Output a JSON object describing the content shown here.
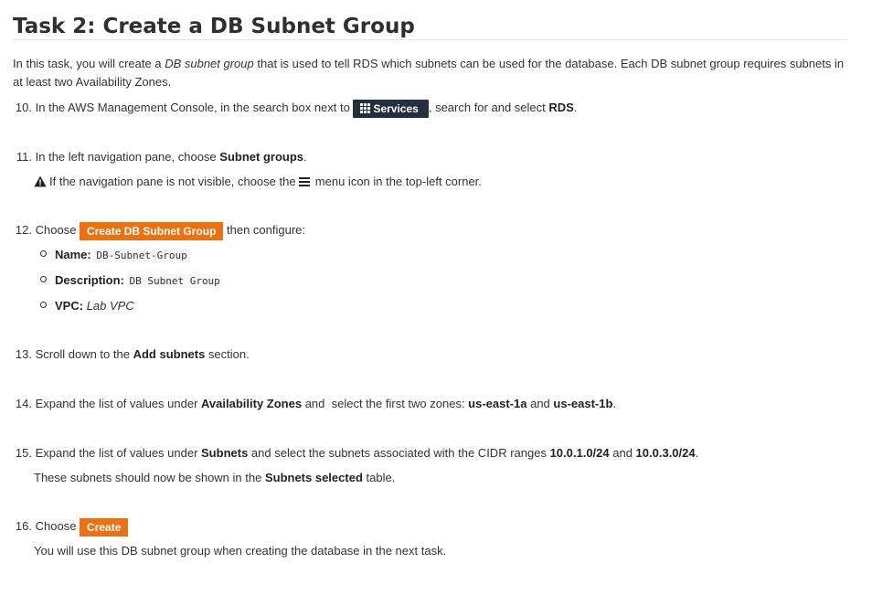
{
  "title": "Task 2: Create a DB Subnet Group",
  "intro": {
    "before": "In this task, you will create a ",
    "em": "DB subnet group",
    "after": " that is used to tell RDS which subnets can be used for the database. Each DB subnet group requires subnets in at least two Availability Zones."
  },
  "steps": {
    "s10": {
      "num": "10.",
      "t1": "In the AWS Management Console, in the search box next to ",
      "button": "Services",
      "t2": ", search for and select ",
      "bold": "RDS",
      "t3": "."
    },
    "s11": {
      "num": "11.",
      "t1": "In the left navigation pane, choose ",
      "bold": "Subnet groups",
      "t2": ".",
      "note": "If the navigation pane is not visible, choose the ",
      "note2": " menu icon in the top-left corner."
    },
    "s12": {
      "num": "12.",
      "t1": "Choose ",
      "button": "Create DB Subnet Group",
      "t2": " then configure:",
      "name_label": "Name:",
      "name_value": "DB-Subnet-Group",
      "desc_label": "Description:",
      "desc_value": "DB Subnet Group",
      "vpc_label": "VPC:",
      "vpc_value": "Lab VPC"
    },
    "s13": {
      "num": "13.",
      "t1": "Scroll down to the ",
      "bold": "Add subnets",
      "t2": " section."
    },
    "s14": {
      "num": "14.",
      "t1": "Expand the list of values under ",
      "bold1": "Availability Zones",
      "t2": " and  select the first two zones: ",
      "bold2": "us-east-1a",
      "t3": " and ",
      "bold3": "us-east-1b",
      "t4": "."
    },
    "s15": {
      "num": "15.",
      "t1": "Expand the list of values under ",
      "bold1": "Subnets",
      "t2": " and select the subnets associated with the CIDR ranges ",
      "bold2": "10.0.1.0/24",
      "t3": " and ",
      "bold3": "10.0.3.0/24",
      "t4": ".",
      "note1": "These subnets should now be shown in the ",
      "note_bold": "Subnets selected",
      "note2": " table."
    },
    "s16": {
      "num": "16.",
      "t1": "Choose ",
      "button": "Create",
      "note": "You will use this DB subnet group when creating the database in the next task."
    }
  },
  "colors": {
    "services_button": "#232f3e",
    "action_button": "#ec7211"
  }
}
